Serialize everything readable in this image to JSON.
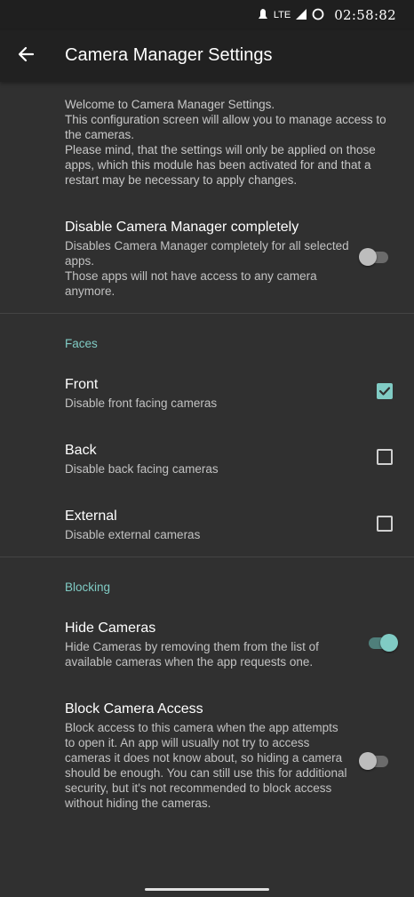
{
  "status_bar": {
    "network": "LTE",
    "time": "02:58:82"
  },
  "app_bar": {
    "title": "Camera Manager Settings"
  },
  "intro_text": "Welcome to Camera Manager Settings.\n This configuration screen will allow you to manage access to the cameras.\n Please mind, that the settings will only be applied on those apps, which this module has been activated for and that a restart may be necessary to apply changes.",
  "disable_completely": {
    "title": "Disable Camera Manager completely",
    "summary": "Disables Camera Manager completely for all selected apps.\n Those apps will not have access to any camera anymore.",
    "enabled": false
  },
  "faces": {
    "header": "Faces",
    "items": [
      {
        "title": "Front",
        "summary": "Disable front facing cameras",
        "checked": true
      },
      {
        "title": "Back",
        "summary": "Disable back facing cameras",
        "checked": false
      },
      {
        "title": "External",
        "summary": "Disable external cameras",
        "checked": false
      }
    ]
  },
  "blocking": {
    "header": "Blocking",
    "items": [
      {
        "title": "Hide Cameras",
        "summary": "Hide Cameras by removing them from the list of available cameras when the app requests one.",
        "enabled": true
      },
      {
        "title": "Block Camera Access",
        "summary": "Block access to this camera when the app attempts to open it. An app will usually not try to access cameras it does not know about, so hiding a camera should be enough. You can still use this for additional security, but it's not recommended to block access without hiding the cameras.",
        "enabled": false
      }
    ]
  },
  "colors": {
    "accent": "#80cbc4",
    "background": "#303030",
    "app_bar": "#212121"
  }
}
